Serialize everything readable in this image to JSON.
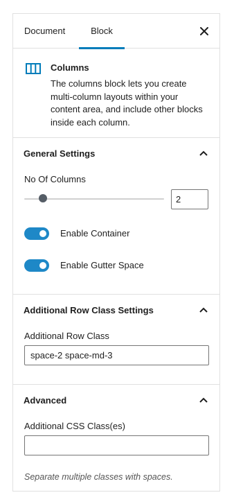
{
  "tabs": {
    "document": "Document",
    "block": "Block"
  },
  "block": {
    "title": "Columns",
    "description": "The columns block lets you create multi-column layouts within your content area, and include other blocks inside each column."
  },
  "general": {
    "title": "General Settings",
    "columns_label": "No Of Columns",
    "columns_value": "2",
    "enable_container_label": "Enable Container",
    "enable_gutter_label": "Enable Gutter Space"
  },
  "row_class": {
    "title": "Additional Row Class Settings",
    "label": "Additional Row Class",
    "value": "space-2 space-md-3"
  },
  "advanced": {
    "title": "Advanced",
    "label": "Additional CSS Class(es)",
    "value": "",
    "help": "Separate multiple classes with spaces."
  },
  "colors": {
    "accent": "#007cba",
    "toggle": "#1e88c7"
  }
}
